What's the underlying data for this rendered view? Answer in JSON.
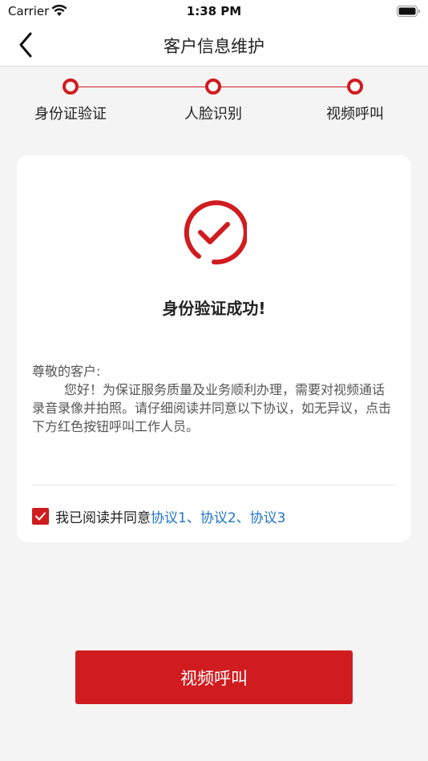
{
  "status_bar": {
    "carrier": "Carrier",
    "time": "1:38 PM"
  },
  "nav": {
    "title": "客户信息维护"
  },
  "steps": [
    {
      "label": "身份证验证"
    },
    {
      "label": "人脸识别"
    },
    {
      "label": "视频呼叫"
    }
  ],
  "card": {
    "success_title": "身份验证成功!",
    "greeting": "尊敬的客户:",
    "body": "您好！为保证服务质量及业务顺利办理，需要对视频通话录音录像并拍照。请仔细阅读并同意以下协议，如无异议，点击下方红色按钮呼叫工作人员。",
    "agree_prefix": "我已阅读并同意",
    "links": [
      "协议1",
      "协议2",
      "协议3"
    ],
    "separator": "、",
    "checkbox_checked": true
  },
  "call_button": {
    "label": "视频呼叫"
  },
  "colors": {
    "accent": "#d01c1f",
    "link": "#1f74c8",
    "background": "#f4f4f4"
  }
}
